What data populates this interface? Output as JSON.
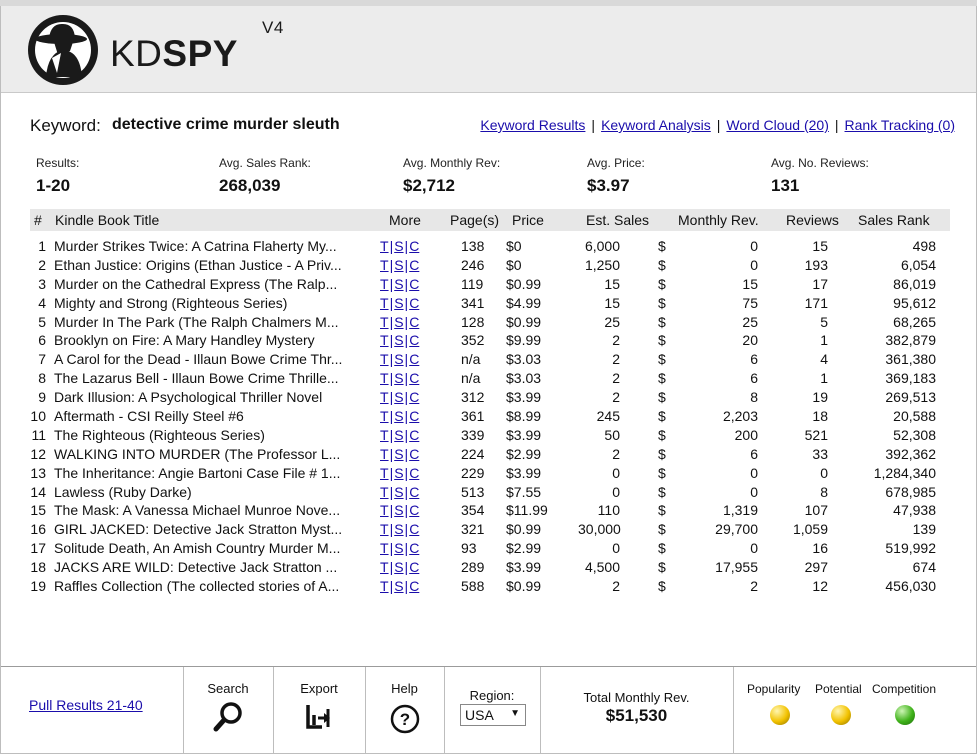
{
  "app": {
    "brand_prefix": "KD",
    "brand_bold": "SPY",
    "version": "V4"
  },
  "keyword": {
    "label": "Keyword:",
    "value": "detective crime murder sleuth"
  },
  "nav_links": [
    "Keyword Results",
    "Keyword Analysis",
    "Word Cloud (20)",
    "Rank Tracking (0)"
  ],
  "summary": [
    {
      "label": "Results:",
      "value": "1-20"
    },
    {
      "label": "Avg. Sales Rank:",
      "value": "268,039"
    },
    {
      "label": "Avg. Monthly Rev:",
      "value": "$2,712"
    },
    {
      "label": "Avg. Price:",
      "value": "$3.97"
    },
    {
      "label": "Avg. No. Reviews:",
      "value": "131"
    }
  ],
  "table": {
    "headers": [
      "#",
      "Kindle Book Title",
      "More",
      "Page(s)",
      "Price",
      "Est. Sales",
      "Monthly Rev.",
      "Reviews",
      "Sales Rank"
    ],
    "more_links": [
      "T",
      "S",
      "C"
    ],
    "rows": [
      {
        "num": "1",
        "title": "Murder Strikes Twice: A Catrina Flaherty My...",
        "pages": "138",
        "price": "$0",
        "sales": "6,000",
        "rev": "0",
        "reviews": "15",
        "rank": "498"
      },
      {
        "num": "2",
        "title": "Ethan Justice: Origins (Ethan Justice - A Priv...",
        "pages": "246",
        "price": "$0",
        "sales": "1,250",
        "rev": "0",
        "reviews": "193",
        "rank": "6,054"
      },
      {
        "num": "3",
        "title": "Murder on the Cathedral Express (The Ralp...",
        "pages": "119",
        "price": "$0.99",
        "sales": "15",
        "rev": "15",
        "reviews": "17",
        "rank": "86,019"
      },
      {
        "num": "4",
        "title": "Mighty and Strong (Righteous Series)",
        "pages": "341",
        "price": "$4.99",
        "sales": "15",
        "rev": "75",
        "reviews": "171",
        "rank": "95,612"
      },
      {
        "num": "5",
        "title": "Murder In The Park (The Ralph Chalmers M...",
        "pages": "128",
        "price": "$0.99",
        "sales": "25",
        "rev": "25",
        "reviews": "5",
        "rank": "68,265"
      },
      {
        "num": "6",
        "title": "Brooklyn on Fire: A Mary Handley Mystery",
        "pages": "352",
        "price": "$9.99",
        "sales": "2",
        "rev": "20",
        "reviews": "1",
        "rank": "382,879"
      },
      {
        "num": "7",
        "title": "A Carol for the Dead - Illaun Bowe Crime Thr...",
        "pages": "n/a",
        "price": "$3.03",
        "sales": "2",
        "rev": "6",
        "reviews": "4",
        "rank": "361,380"
      },
      {
        "num": "8",
        "title": "The Lazarus Bell - Illaun Bowe Crime Thrille...",
        "pages": "n/a",
        "price": "$3.03",
        "sales": "2",
        "rev": "6",
        "reviews": "1",
        "rank": "369,183"
      },
      {
        "num": "9",
        "title": "Dark Illusion: A Psychological Thriller Novel",
        "pages": "312",
        "price": "$3.99",
        "sales": "2",
        "rev": "8",
        "reviews": "19",
        "rank": "269,513"
      },
      {
        "num": "10",
        "title": "Aftermath - CSI Reilly Steel #6",
        "pages": "361",
        "price": "$8.99",
        "sales": "245",
        "rev": "2,203",
        "reviews": "18",
        "rank": "20,588"
      },
      {
        "num": "11",
        "title": "The Righteous (Righteous Series)",
        "pages": "339",
        "price": "$3.99",
        "sales": "50",
        "rev": "200",
        "reviews": "521",
        "rank": "52,308"
      },
      {
        "num": "12",
        "title": "WALKING INTO MURDER (The Professor L...",
        "pages": "224",
        "price": "$2.99",
        "sales": "2",
        "rev": "6",
        "reviews": "33",
        "rank": "392,362"
      },
      {
        "num": "13",
        "title": "The Inheritance: Angie Bartoni Case File # 1...",
        "pages": "229",
        "price": "$3.99",
        "sales": "0",
        "rev": "0",
        "reviews": "0",
        "rank": "1,284,340"
      },
      {
        "num": "14",
        "title": "Lawless (Ruby Darke)",
        "pages": "513",
        "price": "$7.55",
        "sales": "0",
        "rev": "0",
        "reviews": "8",
        "rank": "678,985"
      },
      {
        "num": "15",
        "title": "The Mask: A Vanessa Michael Munroe Nove...",
        "pages": "354",
        "price": "$11.99",
        "sales": "110",
        "rev": "1,319",
        "reviews": "107",
        "rank": "47,938"
      },
      {
        "num": "16",
        "title": "GIRL JACKED: Detective Jack Stratton Myst...",
        "pages": "321",
        "price": "$0.99",
        "sales": "30,000",
        "rev": "29,700",
        "reviews": "1,059",
        "rank": "139"
      },
      {
        "num": "17",
        "title": "Solitude Death, An Amish Country Murder M...",
        "pages": "93",
        "price": "$2.99",
        "sales": "0",
        "rev": "0",
        "reviews": "16",
        "rank": "519,992"
      },
      {
        "num": "18",
        "title": "JACKS ARE WILD: Detective Jack Stratton ...",
        "pages": "289",
        "price": "$3.99",
        "sales": "4,500",
        "rev": "17,955",
        "reviews": "297",
        "rank": "674"
      },
      {
        "num": "19",
        "title": "Raffles Collection (The collected stories of A...",
        "pages": "588",
        "price": "$0.99",
        "sales": "2",
        "rev": "2",
        "reviews": "12",
        "rank": "456,030"
      }
    ],
    "currency_symbol": "$"
  },
  "footer": {
    "pull_results": "Pull Results 21-40",
    "search_label": "Search",
    "export_label": "Export",
    "help_label": "Help",
    "help_glyph": "?",
    "region_label": "Region:",
    "region_value": "USA",
    "region_arrow": "▼",
    "total_label": "Total Monthly Rev.",
    "total_value": "$51,530",
    "indicators": [
      {
        "label": "Popularity",
        "color": "#f2c200"
      },
      {
        "label": "Potential",
        "color": "#f2c200"
      },
      {
        "label": "Competition",
        "color": "#3fb21a"
      }
    ]
  },
  "icons": {
    "logo": "spy-icon",
    "search": "magnifier-icon",
    "export": "export-icon",
    "help": "help-circle-icon"
  }
}
